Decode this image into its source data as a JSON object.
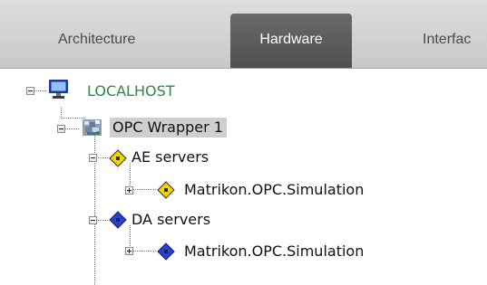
{
  "tabs": [
    {
      "label": "Architecture"
    },
    {
      "label": "Hardware"
    },
    {
      "label": "Interfac"
    }
  ],
  "tree": {
    "localhost": "LOCALHOST",
    "opc_wrapper": "OPC Wrapper 1",
    "ae_servers": "AE servers",
    "ae_simulation": "Matrikon.OPC.Simulation",
    "da_servers": "DA servers",
    "da_simulation": "Matrikon.OPC.Simulation"
  },
  "colors": {
    "localhost_text": "#2b8a3e",
    "ae_diamond": "#f3d600",
    "da_diamond": "#2b3fd0",
    "active_tab": "#5a5a5a",
    "selection": "#cfcfcf"
  }
}
